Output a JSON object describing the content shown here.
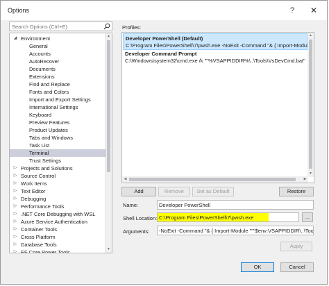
{
  "window": {
    "title": "Options",
    "help_glyph": "?",
    "close_glyph": "✕"
  },
  "search": {
    "placeholder": "Search Options (Ctrl+E)"
  },
  "tree": [
    {
      "label": "Environment",
      "level": 0,
      "expanded": true,
      "selected": false
    },
    {
      "label": "General",
      "level": 1,
      "selected": false
    },
    {
      "label": "Accounts",
      "level": 1,
      "selected": false
    },
    {
      "label": "AutoRecover",
      "level": 1,
      "selected": false
    },
    {
      "label": "Documents",
      "level": 1,
      "selected": false
    },
    {
      "label": "Extensions",
      "level": 1,
      "selected": false
    },
    {
      "label": "Find and Replace",
      "level": 1,
      "selected": false
    },
    {
      "label": "Fonts and Colors",
      "level": 1,
      "selected": false
    },
    {
      "label": "Import and Export Settings",
      "level": 1,
      "selected": false
    },
    {
      "label": "International Settings",
      "level": 1,
      "selected": false
    },
    {
      "label": "Keyboard",
      "level": 1,
      "selected": false
    },
    {
      "label": "Preview Features",
      "level": 1,
      "selected": false
    },
    {
      "label": "Product Updates",
      "level": 1,
      "selected": false
    },
    {
      "label": "Tabs and Windows",
      "level": 1,
      "selected": false
    },
    {
      "label": "Task List",
      "level": 1,
      "selected": false
    },
    {
      "label": "Terminal",
      "level": 1,
      "selected": true
    },
    {
      "label": "Trust Settings",
      "level": 1,
      "selected": false
    },
    {
      "label": "Projects and Solutions",
      "level": 0,
      "expanded": false,
      "selected": false
    },
    {
      "label": "Source Control",
      "level": 0,
      "expanded": false,
      "selected": false
    },
    {
      "label": "Work Items",
      "level": 0,
      "expanded": false,
      "selected": false
    },
    {
      "label": "Text Editor",
      "level": 0,
      "expanded": false,
      "selected": false
    },
    {
      "label": "Debugging",
      "level": 0,
      "expanded": false,
      "selected": false
    },
    {
      "label": "Performance Tools",
      "level": 0,
      "expanded": false,
      "selected": false
    },
    {
      "label": ".NET Core Debugging with WSL",
      "level": 0,
      "expanded": false,
      "selected": false
    },
    {
      "label": "Azure Service Authentication",
      "level": 0,
      "expanded": false,
      "selected": false
    },
    {
      "label": "Container Tools",
      "level": 0,
      "expanded": false,
      "selected": false
    },
    {
      "label": "Cross Platform",
      "level": 0,
      "expanded": false,
      "selected": false
    },
    {
      "label": "Database Tools",
      "level": 0,
      "expanded": false,
      "selected": false
    },
    {
      "label": "EF Core Power Tools",
      "level": 0,
      "expanded": false,
      "selected": false
    }
  ],
  "profiles": {
    "label": "Profiles:",
    "items": [
      {
        "name": "Developer PowerShell (Default)",
        "command": "C:\\Program Files\\PowerShell\\7\\pwsh.exe -NoExit -Command \"& { Import-Module",
        "selected": true
      },
      {
        "name": "Developer Command Prompt",
        "command": "C:\\Windows\\system32\\cmd.exe /k \"\"%VSAPPIDDIR%\\..\\Tools\\VsDevCmd.bat\"",
        "selected": false
      }
    ]
  },
  "buttons": {
    "add": "Add",
    "remove": "Remove",
    "set_default": "Set as Default",
    "restore": "Restore",
    "browse": "...",
    "apply": "Apply",
    "ok": "OK",
    "cancel": "Cancel"
  },
  "fields": {
    "name_label": "Name:",
    "name_value": "Developer PowerShell",
    "shell_label": "Shell Location:",
    "shell_value": "C:\\Program Files\\PowerShell\\7\\pwsh.exe",
    "args_label": "Arguments:",
    "args_value": "-NoExit -Command \"& { Import-Module \"\"\"$env:VSAPPIDDIR\\..\\Tools"
  },
  "colors": {
    "accent": "#0078d7",
    "selection": "#cce8ff",
    "tree_selection": "#cccedb",
    "highlight": "#ffff00"
  }
}
